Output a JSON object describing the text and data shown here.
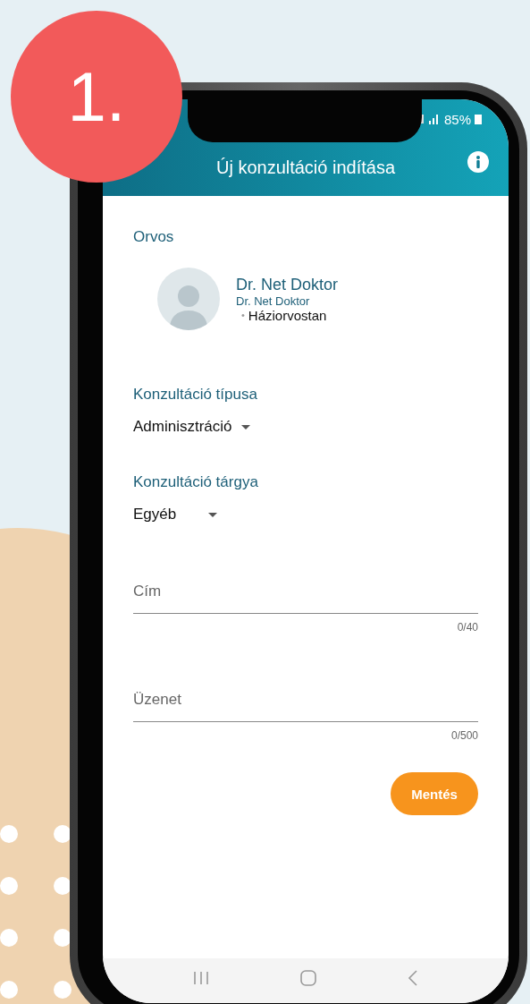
{
  "badge": "1.",
  "status_bar": {
    "battery": "85%"
  },
  "app_bar": {
    "title": "Új konzultáció indítása"
  },
  "doctor_section": {
    "label": "Orvos",
    "name": "Dr. Net Doktor",
    "subtitle": "Dr. Net Doktor",
    "bullet": "•",
    "specialty": "Háziorvostan"
  },
  "dropdowns": [
    {
      "label": "Konzultáció típusa",
      "value": "Adminisztráció"
    },
    {
      "label": "Konzultáció tárgya",
      "value": "Egyéb"
    }
  ],
  "text_fields": [
    {
      "placeholder": "Cím",
      "counter": "0/40"
    },
    {
      "placeholder": "Üzenet",
      "counter": "0/500"
    }
  ],
  "save_button": "Mentés"
}
